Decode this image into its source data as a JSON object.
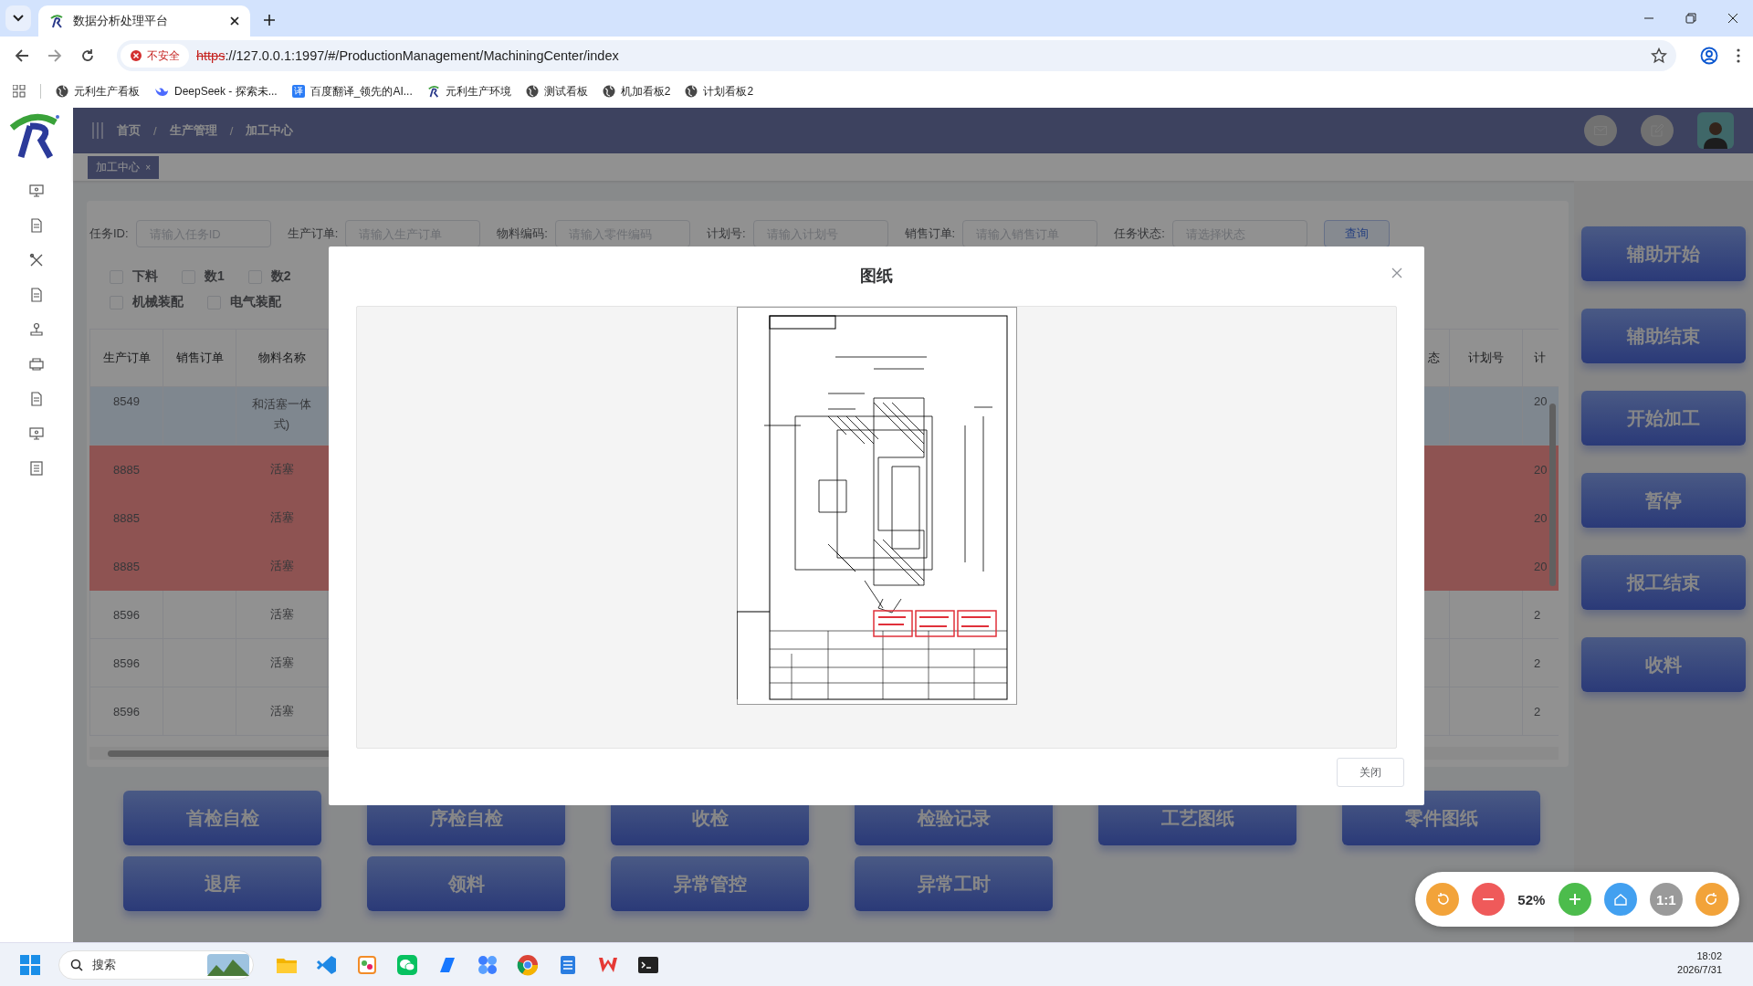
{
  "browser": {
    "tab_title": "数据分析处理平台",
    "security": "不安全",
    "url_scheme": "https",
    "url_rest": "://127.0.0.1:1997/#/ProductionManagement/MachiningCenter/index",
    "bookmarks": [
      {
        "kind": "globe",
        "label": "元利生产看板"
      },
      {
        "kind": "whale",
        "label": "DeepSeek - 探索未..."
      },
      {
        "kind": "translate",
        "icon_text": "译",
        "label": "百度翻译_领先的AI..."
      },
      {
        "kind": "logo",
        "label": "元利生产环境"
      },
      {
        "kind": "globe",
        "label": "测试看板"
      },
      {
        "kind": "globe",
        "label": "机加看板2"
      },
      {
        "kind": "globe",
        "label": "计划看板2"
      }
    ]
  },
  "breadcrumb": [
    "首页",
    "生产管理",
    "加工中心"
  ],
  "breadcrumb_separator": "/",
  "open_tags": [
    {
      "label": "加工中心",
      "close_mark": "×",
      "selected": true
    }
  ],
  "filters": [
    {
      "label": "任务ID:",
      "placeholder": "请输入任务ID"
    },
    {
      "label": "生产订单:",
      "placeholder": "请输入生产订单"
    },
    {
      "label": "物料编码:",
      "placeholder": "请输入零件编码"
    },
    {
      "label": "计划号:",
      "placeholder": "请输入计划号"
    },
    {
      "label": "销售订单:",
      "placeholder": "请输入销售订单"
    },
    {
      "label": "任务状态:",
      "placeholder": "请选择状态"
    }
  ],
  "search_button": "查询",
  "checkbox_rows": [
    [
      {
        "label": "下料",
        "checked": false
      },
      {
        "label": "数1",
        "checked": false
      },
      {
        "label": "数2",
        "checked": false
      }
    ],
    [
      {
        "label": "机械装配",
        "checked": false
      },
      {
        "label": "电气装配",
        "checked": false
      }
    ]
  ],
  "table": {
    "columns": [
      "生产订单",
      "销售订单",
      "物料名称",
      "态",
      "计划号",
      "计"
    ],
    "rows": [
      {
        "selected": true,
        "alert": false,
        "production_order": "8549",
        "material_name": "和活塞一体式)",
        "column_6": "20"
      },
      {
        "selected": false,
        "alert": true,
        "production_order": "8885",
        "material_name": "活塞",
        "column_6": "20"
      },
      {
        "selected": false,
        "alert": true,
        "production_order": "8885",
        "material_name": "活塞",
        "column_6": "20"
      },
      {
        "selected": false,
        "alert": true,
        "production_order": "8885",
        "material_name": "活塞",
        "column_6": "20"
      },
      {
        "selected": false,
        "alert": false,
        "production_order": "8596",
        "material_name": "活塞",
        "column_6": "2"
      },
      {
        "selected": false,
        "alert": false,
        "production_order": "8596",
        "material_name": "活塞",
        "column_6": "2"
      },
      {
        "selected": false,
        "alert": false,
        "production_order": "8596",
        "material_name": "活塞",
        "column_6": "2"
      }
    ]
  },
  "action_buttons": [
    "辅助开始",
    "辅助结束",
    "开始加工",
    "暂停",
    "报工结束",
    "收料"
  ],
  "bottom_buttons": [
    [
      "首检自检",
      "序检自检",
      "收检",
      "检验记录",
      "工艺图纸",
      "零件图纸"
    ],
    [
      "退库",
      "领料",
      "异常管控",
      "异常工时"
    ]
  ],
  "modal": {
    "title": "图纸",
    "close_button": "关闭"
  },
  "image_viewer": {
    "zoom": "52%",
    "actual_size": "1:1"
  },
  "taskbar": {
    "search_placeholder": "搜索",
    "time": "18:02",
    "date": "2026/7/31"
  }
}
